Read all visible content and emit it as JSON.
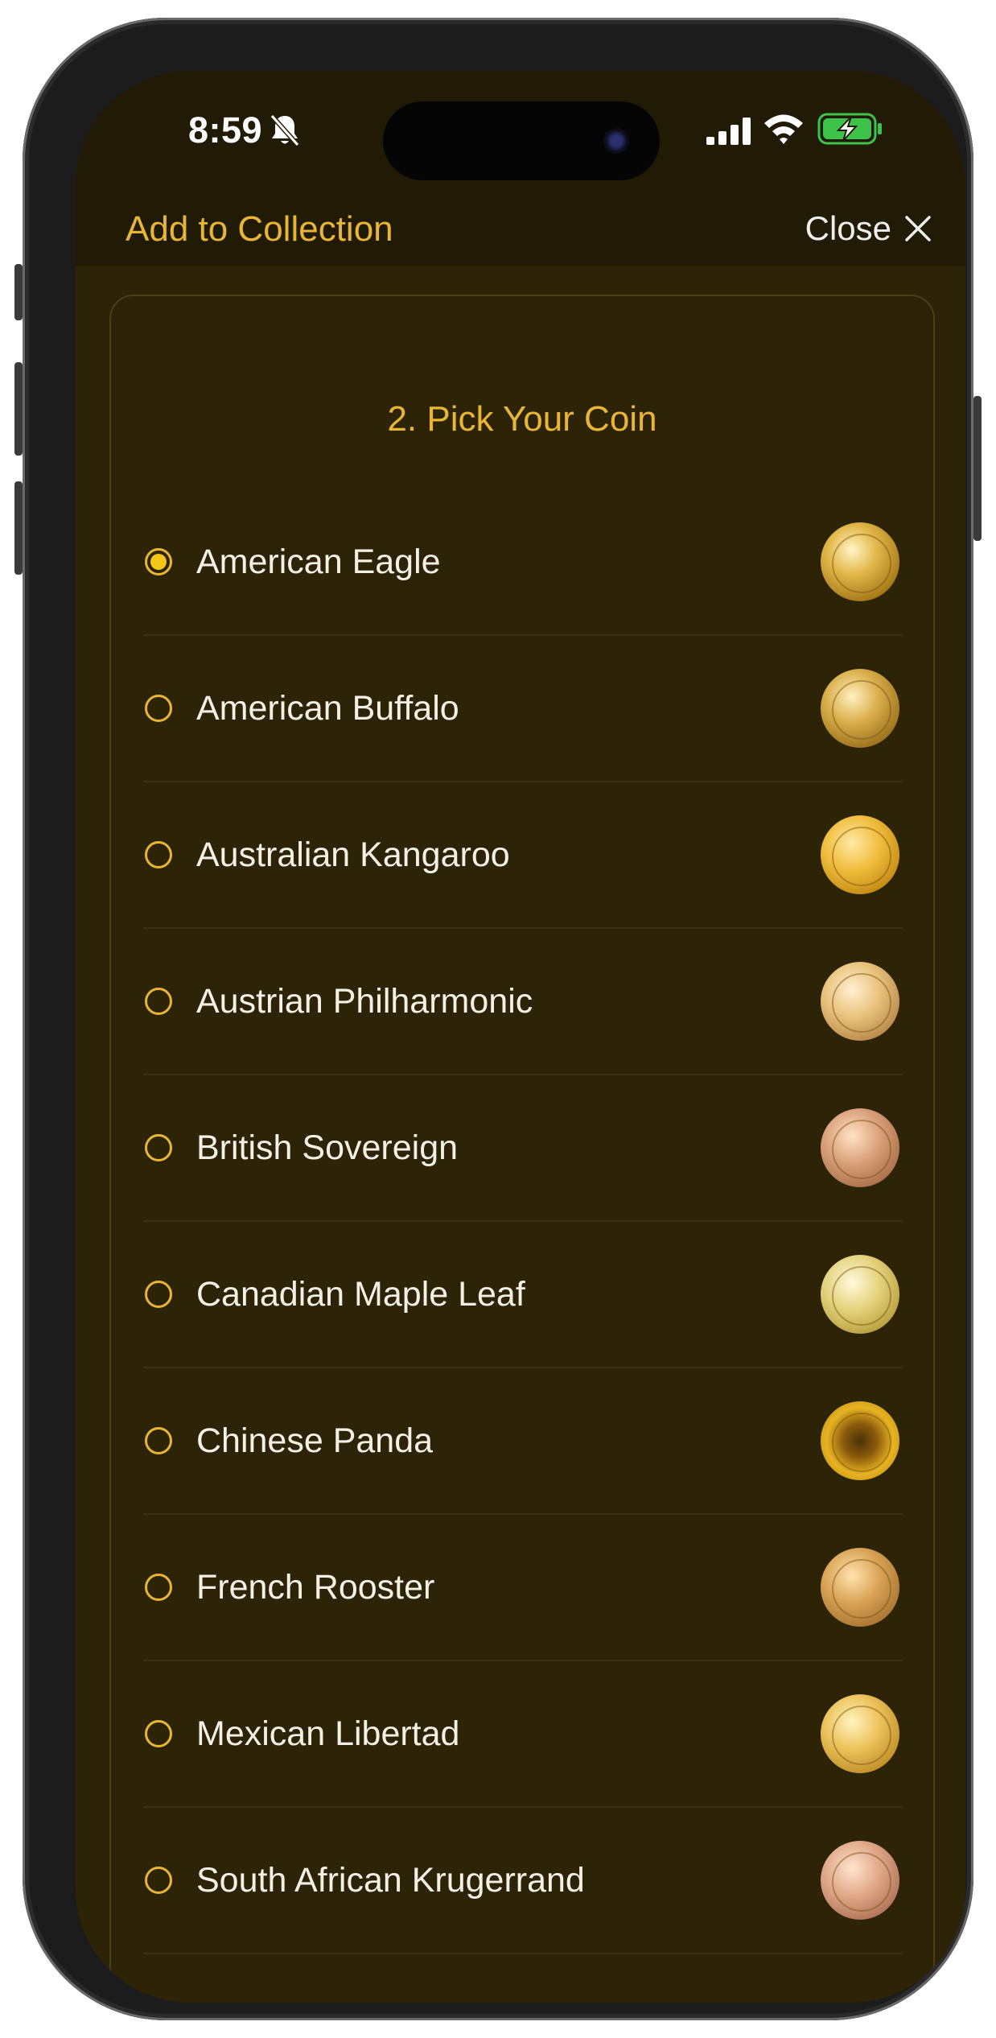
{
  "status_bar": {
    "time": "8:59",
    "icons": [
      "bell-slash-icon",
      "cellular-signal-icon",
      "wifi-icon",
      "battery-charging-icon"
    ]
  },
  "header": {
    "title": "Add to Collection",
    "close_label": "Close",
    "close_icon": "close-icon"
  },
  "card": {
    "title": "2. Pick Your Coin"
  },
  "coins": [
    {
      "name": "American Eagle",
      "selected": true,
      "image": "american-eagle-coin-image"
    },
    {
      "name": "American Buffalo",
      "selected": false,
      "image": "american-buffalo-coin-image"
    },
    {
      "name": "Australian Kangaroo",
      "selected": false,
      "image": "australian-kangaroo-coin-image"
    },
    {
      "name": "Austrian Philharmonic",
      "selected": false,
      "image": "austrian-philharmonic-coin-image"
    },
    {
      "name": "British Sovereign",
      "selected": false,
      "image": "british-sovereign-coin-image"
    },
    {
      "name": "Canadian Maple Leaf",
      "selected": false,
      "image": "canadian-maple-leaf-coin-image"
    },
    {
      "name": "Chinese Panda",
      "selected": false,
      "image": "chinese-panda-coin-image"
    },
    {
      "name": "French Rooster",
      "selected": false,
      "image": "french-rooster-coin-image"
    },
    {
      "name": "Mexican Libertad",
      "selected": false,
      "image": "mexican-libertad-coin-image"
    },
    {
      "name": "South African Krugerrand",
      "selected": false,
      "image": "south-african-krugerrand-coin-image"
    }
  ],
  "colors": {
    "accent": "#e8b634",
    "background": "#2d2407",
    "header_background": "#211b05",
    "radio_fill": "#f5c518",
    "text": "#f4f0e6"
  }
}
